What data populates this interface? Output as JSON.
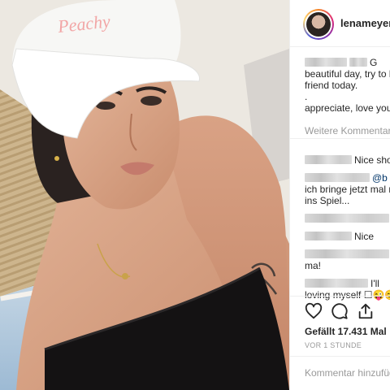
{
  "post": {
    "cap_text": "Peachy",
    "username": "lenameyerla",
    "likes": "Gefällt 17.431 Mal",
    "time": "VOR 1 STUNDE",
    "add_comment_placeholder": "Kommentar hinzufügen..."
  },
  "caption": {
    "suffix": "G",
    "line2": "beautiful day, try to b",
    "line3": "friend today.",
    "line4": ".",
    "line5": "appreciate, love your"
  },
  "more_comments": "Weitere Kommentar",
  "comments": {
    "c1_text": "Nice sho",
    "c2_mention": "@b",
    "c2_line2": "ich bringe jetzt mal m",
    "c2_line3": "ins Spiel...",
    "c4_text": "Nice",
    "c5_line2": "ma!",
    "c6_suffix": "I'll",
    "c6_line2": "loving myself ☐😜😊"
  },
  "icons": {
    "heart": "heart-icon",
    "comment": "comment-icon",
    "share": "share-icon"
  },
  "colors": {
    "cap": "#ffffff",
    "cap_text": "#f2a6a6",
    "mention": "#003569",
    "muted": "#999999"
  }
}
